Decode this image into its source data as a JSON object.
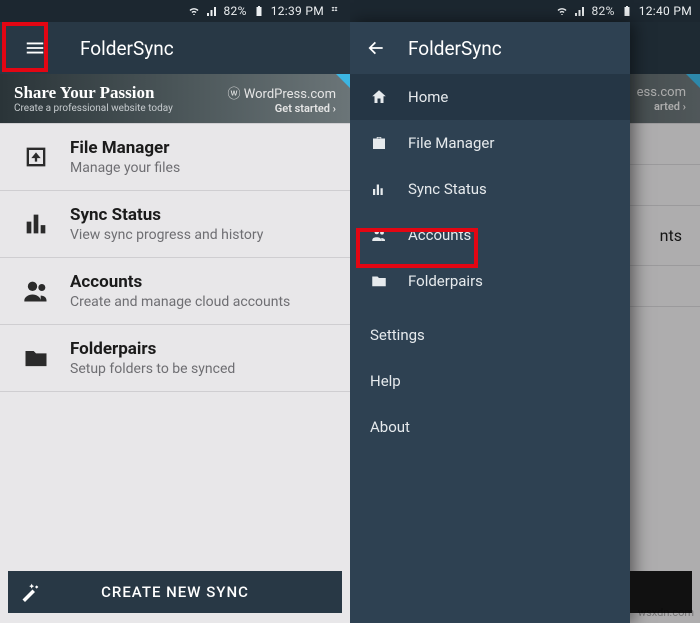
{
  "status": {
    "battery": "82%",
    "time_left": "12:39 PM",
    "time_right": "12:40 PM"
  },
  "app": {
    "title": "FolderSync"
  },
  "ad": {
    "headline": "Share Your Passion",
    "subline": "Create a professional website today",
    "brand": "WordPress.com",
    "cta": "Get started ›"
  },
  "main_items": [
    {
      "title": "File Manager",
      "subtitle": "Manage your files"
    },
    {
      "title": "Sync Status",
      "subtitle": "View sync progress and history"
    },
    {
      "title": "Accounts",
      "subtitle": "Create and manage cloud accounts"
    },
    {
      "title": "Folderpairs",
      "subtitle": "Setup folders to be synced"
    }
  ],
  "bottom_button": "CREATE NEW SYNC",
  "peek_ad": {
    "brand_tail": "ess.com",
    "cta_tail": "arted ›"
  },
  "peek_items": [
    "",
    "",
    "nts",
    ""
  ],
  "drawer": {
    "title": "FolderSync",
    "items": [
      {
        "label": "Home",
        "selected": true
      },
      {
        "label": "File Manager",
        "selected": false
      },
      {
        "label": "Sync Status",
        "selected": false
      },
      {
        "label": "Accounts",
        "selected": false
      },
      {
        "label": "Folderpairs",
        "selected": false
      }
    ],
    "footer": [
      "Settings",
      "Help",
      "About"
    ]
  },
  "watermark": "wsxdn.com"
}
